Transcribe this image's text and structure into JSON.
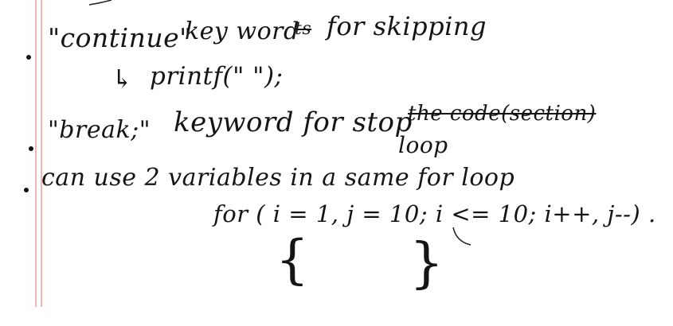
{
  "notes": {
    "line1": {
      "keyword": "\"continue\"",
      "before_strike": "key word",
      "struck": "ts",
      "after_strike": "for skipping"
    },
    "line2": {
      "arrow": "↳",
      "code": "printf(\" \");"
    },
    "line3": {
      "keyword": "\"break;\"",
      "text": "keyword for stop",
      "struck": "the code(section)",
      "correction": "loop"
    },
    "line4": {
      "text": "can use 2 variables in a same for loop"
    },
    "line5": {
      "code": "for ( i = 1, j = 10;  i <= 10; i++, j--) ."
    },
    "braces": {
      "open": "{",
      "close": "}"
    }
  }
}
